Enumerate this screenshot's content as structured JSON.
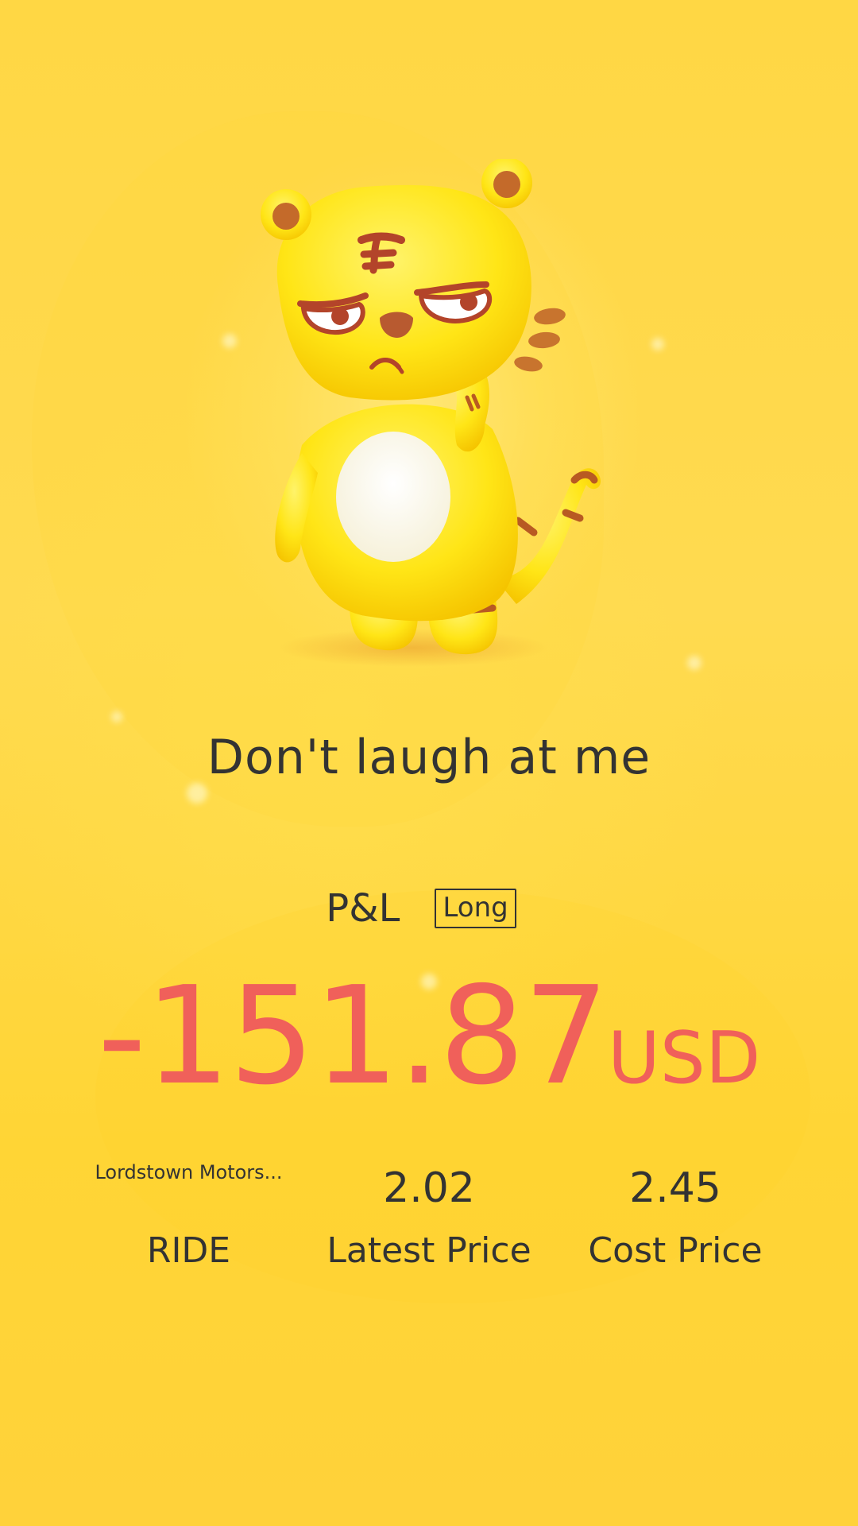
{
  "message": "Don't laugh at me",
  "pnl": {
    "label": "P&L",
    "position_badge": "Long",
    "value": "-151.87",
    "currency": "USD",
    "value_color": "#F0605A"
  },
  "stock": {
    "name": "Lordstown Motors...",
    "symbol": "RIDE"
  },
  "latest_price": {
    "value": "2.02",
    "label": "Latest Price"
  },
  "cost_price": {
    "value": "2.45",
    "label": "Cost Price"
  },
  "colors": {
    "background": "#FFD93A",
    "text": "#333333",
    "loss": "#F0605A"
  },
  "illustration": "tiger-mascot-icon"
}
